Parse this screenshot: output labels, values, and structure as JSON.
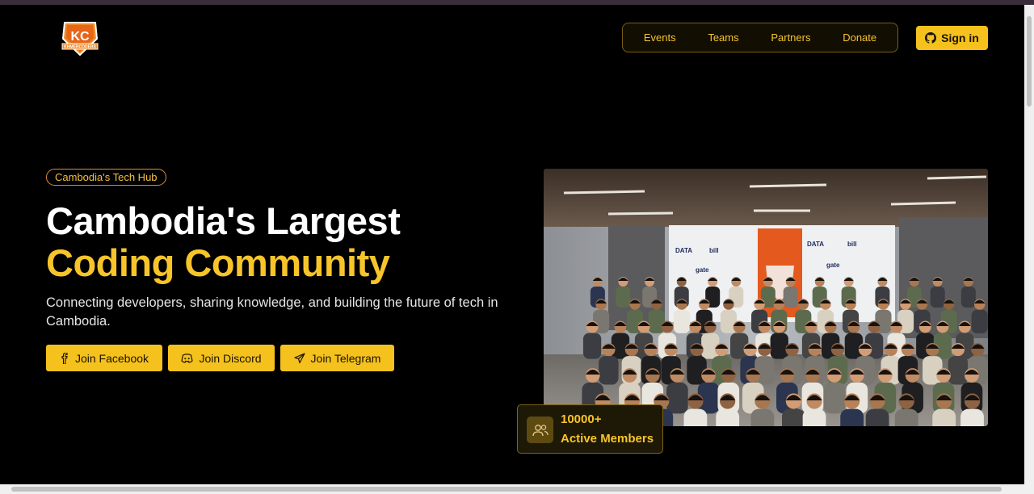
{
  "brand": {
    "logo_text": "KC",
    "logo_subtext": "KHMERCODERS",
    "icon": "kc-shield-logo"
  },
  "nav": {
    "items": [
      "Events",
      "Teams",
      "Partners",
      "Donate"
    ]
  },
  "header": {
    "signin_label": "Sign in",
    "signin_icon": "github-icon"
  },
  "hero": {
    "badge": "Cambodia's Tech Hub",
    "title_line1": "Cambodia's Largest",
    "title_line2": "Coding Community",
    "description": "Connecting developers, sharing knowledge, and building the future of tech in Cambodia.",
    "buttons": [
      {
        "label": "Join Facebook",
        "icon": "facebook-icon"
      },
      {
        "label": "Join Discord",
        "icon": "discord-icon"
      },
      {
        "label": "Join Telegram",
        "icon": "telegram-icon"
      }
    ]
  },
  "stats": {
    "members_count": "10000+",
    "members_label": "Active Members",
    "icon": "users-icon"
  },
  "photo": {
    "banner_logos": [
      "DATA",
      "bill",
      "gate",
      "DATA",
      "bill",
      "gate"
    ]
  },
  "colors": {
    "accent": "#f5c11d",
    "accent_text": "#f7c52a",
    "background": "#000000",
    "badge_border": "#e08b3e"
  }
}
